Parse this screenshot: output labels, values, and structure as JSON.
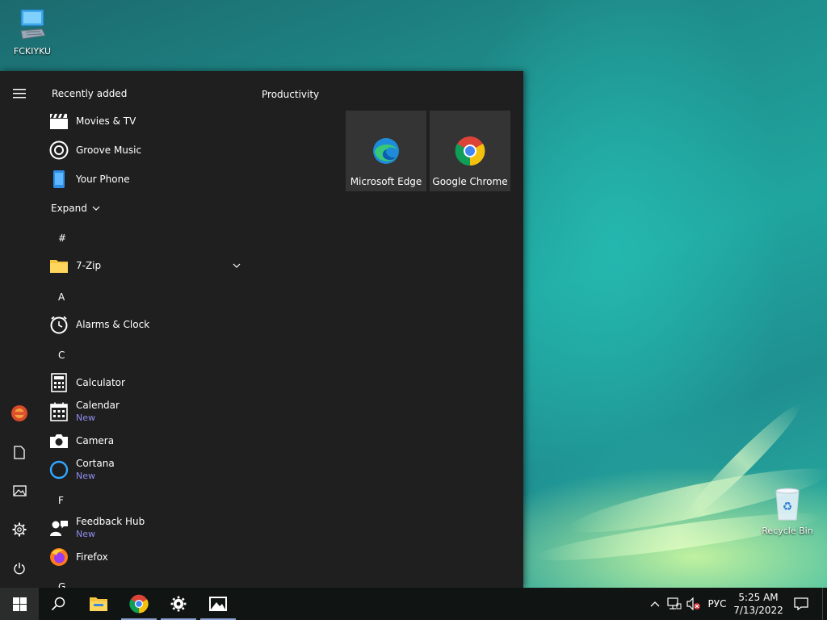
{
  "desktop": {
    "computer_icon_label": "FCKIYKU",
    "recycle_bin_label": "Recycle Bin"
  },
  "start_menu": {
    "recently_added_title": "Recently added",
    "recent": [
      {
        "label": "Movies & TV",
        "icon": "clapperboard-icon"
      },
      {
        "label": "Groove Music",
        "icon": "groove-disc-icon"
      },
      {
        "label": "Your Phone",
        "icon": "phone-icon"
      }
    ],
    "expand_label": "Expand",
    "letters": {
      "hash": "#",
      "a": "A",
      "c": "C",
      "f": "F",
      "g": "G"
    },
    "apps": {
      "zip": {
        "label": "7-Zip",
        "icon": "folder-icon"
      },
      "alarms": {
        "label": "Alarms & Clock",
        "icon": "clock-icon"
      },
      "calculator": {
        "label": "Calculator",
        "icon": "calculator-icon"
      },
      "calendar": {
        "label": "Calendar",
        "sub": "New",
        "icon": "calendar-icon"
      },
      "camera": {
        "label": "Camera",
        "icon": "camera-icon"
      },
      "cortana": {
        "label": "Cortana",
        "sub": "New",
        "icon": "cortana-ring-icon"
      },
      "feedback": {
        "label": "Feedback Hub",
        "sub": "New",
        "icon": "feedback-person-icon"
      },
      "firefox": {
        "label": "Firefox",
        "icon": "firefox-icon"
      }
    },
    "group_title": "Productivity",
    "tiles": [
      {
        "label": "Microsoft Edge",
        "icon": "edge-icon"
      },
      {
        "label": "Google Chrome",
        "icon": "chrome-icon"
      }
    ]
  },
  "taskbar": {
    "lang": "РУС",
    "time": "5:25 AM",
    "date": "7/13/2022"
  },
  "colors": {
    "start_bg": "#1f1f1f",
    "tile_bg": "#343434",
    "new_badge": "#8e8cf0",
    "taskbar_bg": "#101412"
  }
}
